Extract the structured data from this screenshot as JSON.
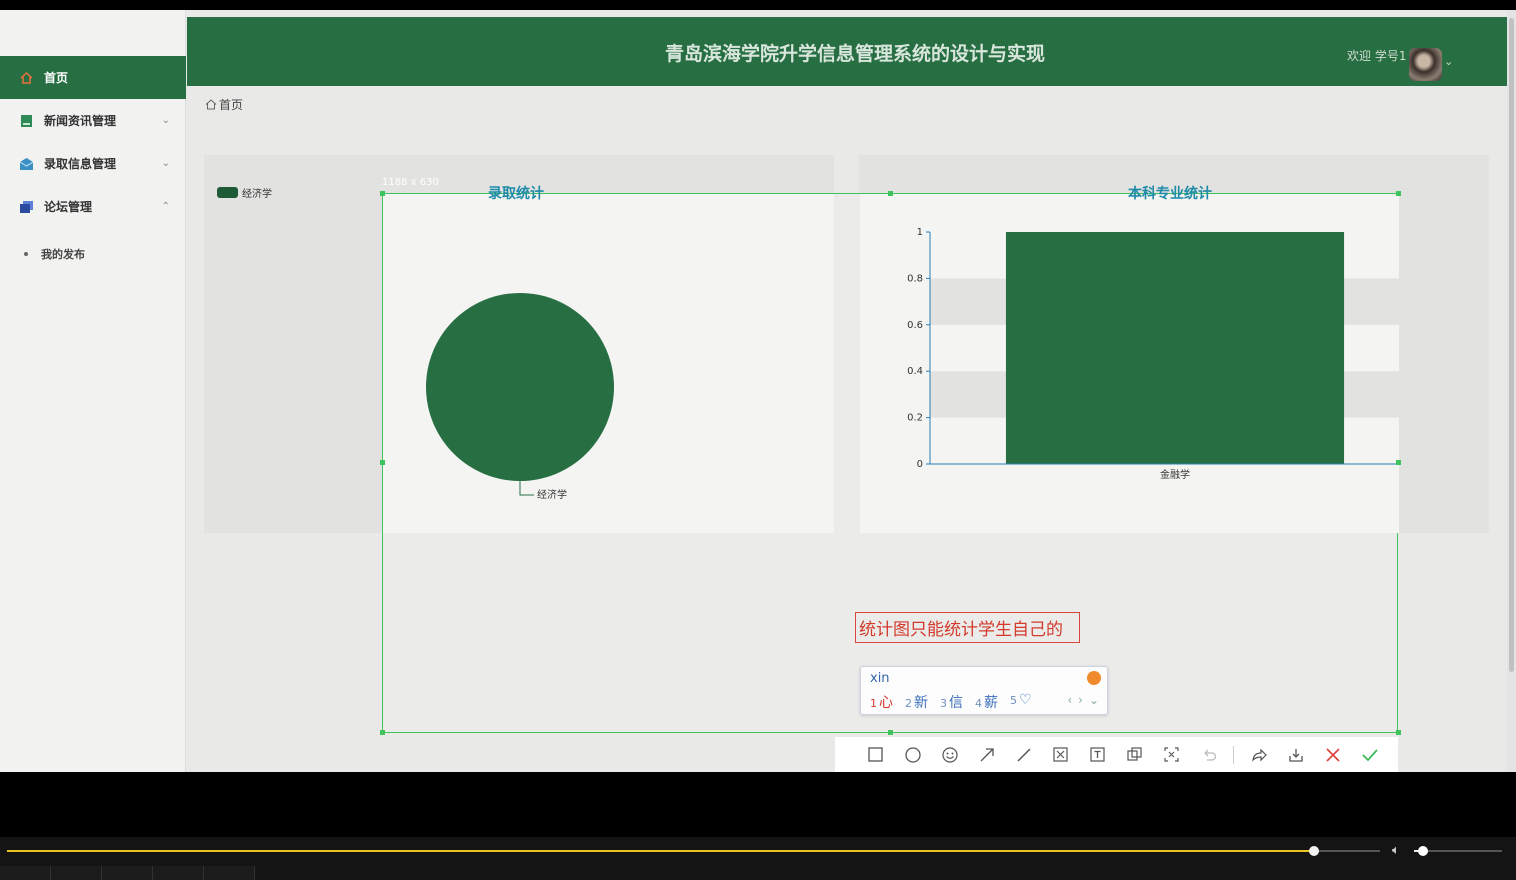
{
  "app": {
    "title": "青岛滨海学院升学信息管理系统的设计与实现",
    "welcome": "欢迎 学号1",
    "breadcrumb": "首页"
  },
  "sidebar": {
    "items": [
      {
        "label": "首页",
        "icon": "home-icon",
        "active": true
      },
      {
        "label": "新闻资讯管理",
        "icon": "news-icon",
        "expanded": false
      },
      {
        "label": "录取信息管理",
        "icon": "mail-icon",
        "expanded": false
      },
      {
        "label": "论坛管理",
        "icon": "forum-icon",
        "expanded": true
      }
    ],
    "subitems": [
      {
        "label": "我的发布"
      }
    ]
  },
  "selection": {
    "size_label": "1188 x 630",
    "annotation_text": "统计图只能统计学生自己的"
  },
  "ime": {
    "input": "xin",
    "candidates": [
      {
        "num": "1",
        "text": "心"
      },
      {
        "num": "2",
        "text": "新"
      },
      {
        "num": "3",
        "text": "信"
      },
      {
        "num": "4",
        "text": "薪"
      },
      {
        "num": "5",
        "text": "♡"
      }
    ]
  },
  "toolbar": {
    "tools": [
      "rectangle-tool-icon",
      "ellipse-tool-icon",
      "emoji-tool-icon",
      "arrow-tool-icon",
      "line-tool-icon",
      "mosaic-tool-icon",
      "text-tool-icon",
      "pin-tool-icon",
      "ocr-tool-icon",
      "undo-icon",
      "share-icon",
      "download-icon",
      "cancel-icon",
      "confirm-icon"
    ]
  },
  "player": {
    "progress": 0.952,
    "volume": 0.1
  },
  "colors": {
    "brand_green": "#276e43",
    "selection_green": "#3fc35d",
    "title_blue": "#1f8ba8",
    "annotation_red": "#d33a2c"
  },
  "chart_data": [
    {
      "type": "pie",
      "title": "录取统计",
      "legend": [
        "经济学"
      ],
      "slices": [
        {
          "label": "经济学",
          "value": 1
        }
      ]
    },
    {
      "type": "bar",
      "title": "本科专业统计",
      "categories": [
        "金融学"
      ],
      "values": [
        1
      ],
      "ylim": [
        0,
        1
      ],
      "yticks": [
        "0",
        "0.2",
        "0.4",
        "0.6",
        "0.8",
        "1"
      ]
    }
  ]
}
